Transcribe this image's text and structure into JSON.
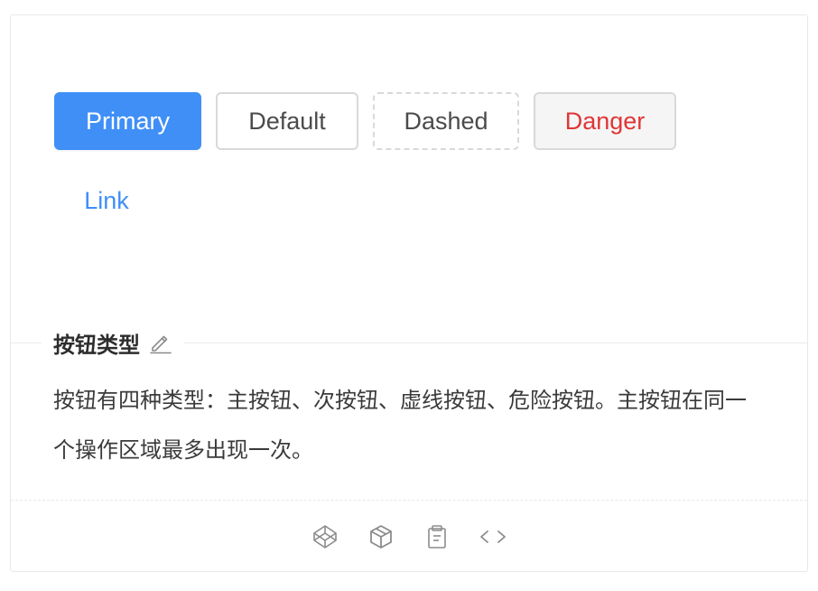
{
  "buttons": {
    "primary": "Primary",
    "default": "Default",
    "dashed": "Dashed",
    "danger": "Danger",
    "link": "Link"
  },
  "meta": {
    "title": "按钮类型",
    "description": "按钮有四种类型：主按钮、次按钮、虚线按钮、危险按钮。主按钮在同一个操作区域最多出现一次。"
  },
  "actions": {
    "icons": [
      "codepen-icon",
      "codesandbox-icon",
      "copy-icon",
      "code-icon"
    ]
  },
  "colors": {
    "primary": "#3f8ff7",
    "danger": "#e03636",
    "border": "#d9d9d9",
    "text": "#3a3a3a",
    "icon": "#8c8c8c"
  }
}
